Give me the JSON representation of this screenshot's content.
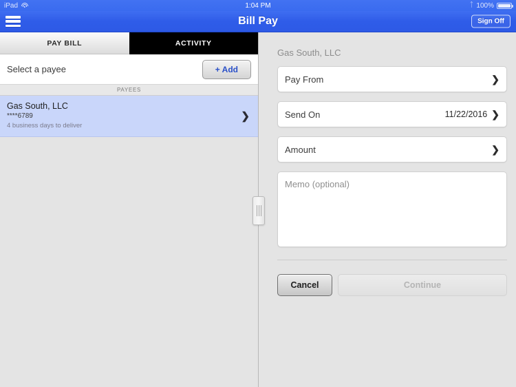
{
  "statusbar": {
    "device_label": "iPad",
    "wifi_icon": "wifi-icon",
    "time": "1:04 PM",
    "bluetooth_icon": "bluetooth-icon",
    "battery_percent": "100%",
    "battery_icon": "battery-icon"
  },
  "navbar": {
    "menu_icon": "hamburger-menu-icon",
    "title": "Bill Pay",
    "signoff_label": "Sign Off"
  },
  "tabs": [
    {
      "label": "PAY BILL",
      "active": false
    },
    {
      "label": "ACTIVITY",
      "active": true
    }
  ],
  "left_panel": {
    "select_payee_label": "Select a payee",
    "add_button_label": "+ Add",
    "list_header": "PAYEES",
    "payees": [
      {
        "name": "Gas South, LLC",
        "account": "****6789",
        "note": "4 business days to deliver",
        "selected": true,
        "chevron": "chevron-right-icon"
      }
    ]
  },
  "right_panel": {
    "title": "Gas South, LLC",
    "fields": [
      {
        "label": "Pay From",
        "value": "",
        "chevron": "chevron-right-icon"
      },
      {
        "label": "Send On",
        "value": "11/22/2016",
        "chevron": "chevron-right-icon"
      },
      {
        "label": "Amount",
        "value": "",
        "chevron": "chevron-right-icon"
      }
    ],
    "memo_placeholder": "Memo (optional)",
    "cancel_label": "Cancel",
    "continue_label": "Continue",
    "continue_enabled": false,
    "drag_handle": "split-view-drag-handle"
  },
  "colors": {
    "nav_blue": "#2f5ce8",
    "accent_blue": "#2a50c8",
    "row_selected": "#c9d6fa",
    "panel_bg": "#e4e4e4",
    "active_tab_bg": "#000000"
  }
}
